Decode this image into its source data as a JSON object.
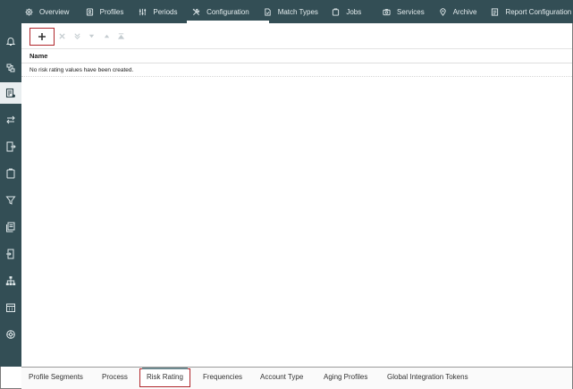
{
  "topnav": {
    "tabs": [
      {
        "label": "Overview",
        "icon": "gear-icon"
      },
      {
        "label": "Profiles",
        "icon": "profiles-icon"
      },
      {
        "label": "Periods",
        "icon": "sliders-icon"
      },
      {
        "label": "Configuration",
        "icon": "tools-icon",
        "active": true
      },
      {
        "label": "Match Types",
        "icon": "match-types-icon"
      },
      {
        "label": "Jobs",
        "icon": "jobs-icon"
      },
      {
        "label": "Services",
        "icon": "services-icon"
      },
      {
        "label": "Archive",
        "icon": "archive-icon"
      },
      {
        "label": "Report Configuration",
        "icon": "report-icon"
      }
    ]
  },
  "rail": {
    "icons": [
      "bell-icon",
      "reconcile-icon",
      "list-settings-icon",
      "transfer-icon",
      "export-doc-icon",
      "clipboard-icon",
      "filter-icon",
      "documents-icon",
      "import-doc-icon",
      "hierarchy-icon",
      "calendar-icon",
      "settings-wheel-icon"
    ],
    "active_index": 2
  },
  "toolbar": {
    "icons": [
      "add-icon",
      "delete-icon",
      "move-bottom-icon",
      "move-down-icon",
      "move-up-icon",
      "move-top-icon"
    ]
  },
  "table": {
    "column_header": "Name",
    "empty_message": "No risk rating values have been created."
  },
  "bottom_tabs": [
    {
      "label": "Profile Segments"
    },
    {
      "label": "Process"
    },
    {
      "label": "Risk Rating",
      "active": true
    },
    {
      "label": "Frequencies"
    },
    {
      "label": "Account Type"
    },
    {
      "label": "Aging Profiles"
    },
    {
      "label": "Global Integration Tokens"
    }
  ],
  "colors": {
    "nav_background": "#334e55",
    "highlight_border": "#b0262b"
  }
}
